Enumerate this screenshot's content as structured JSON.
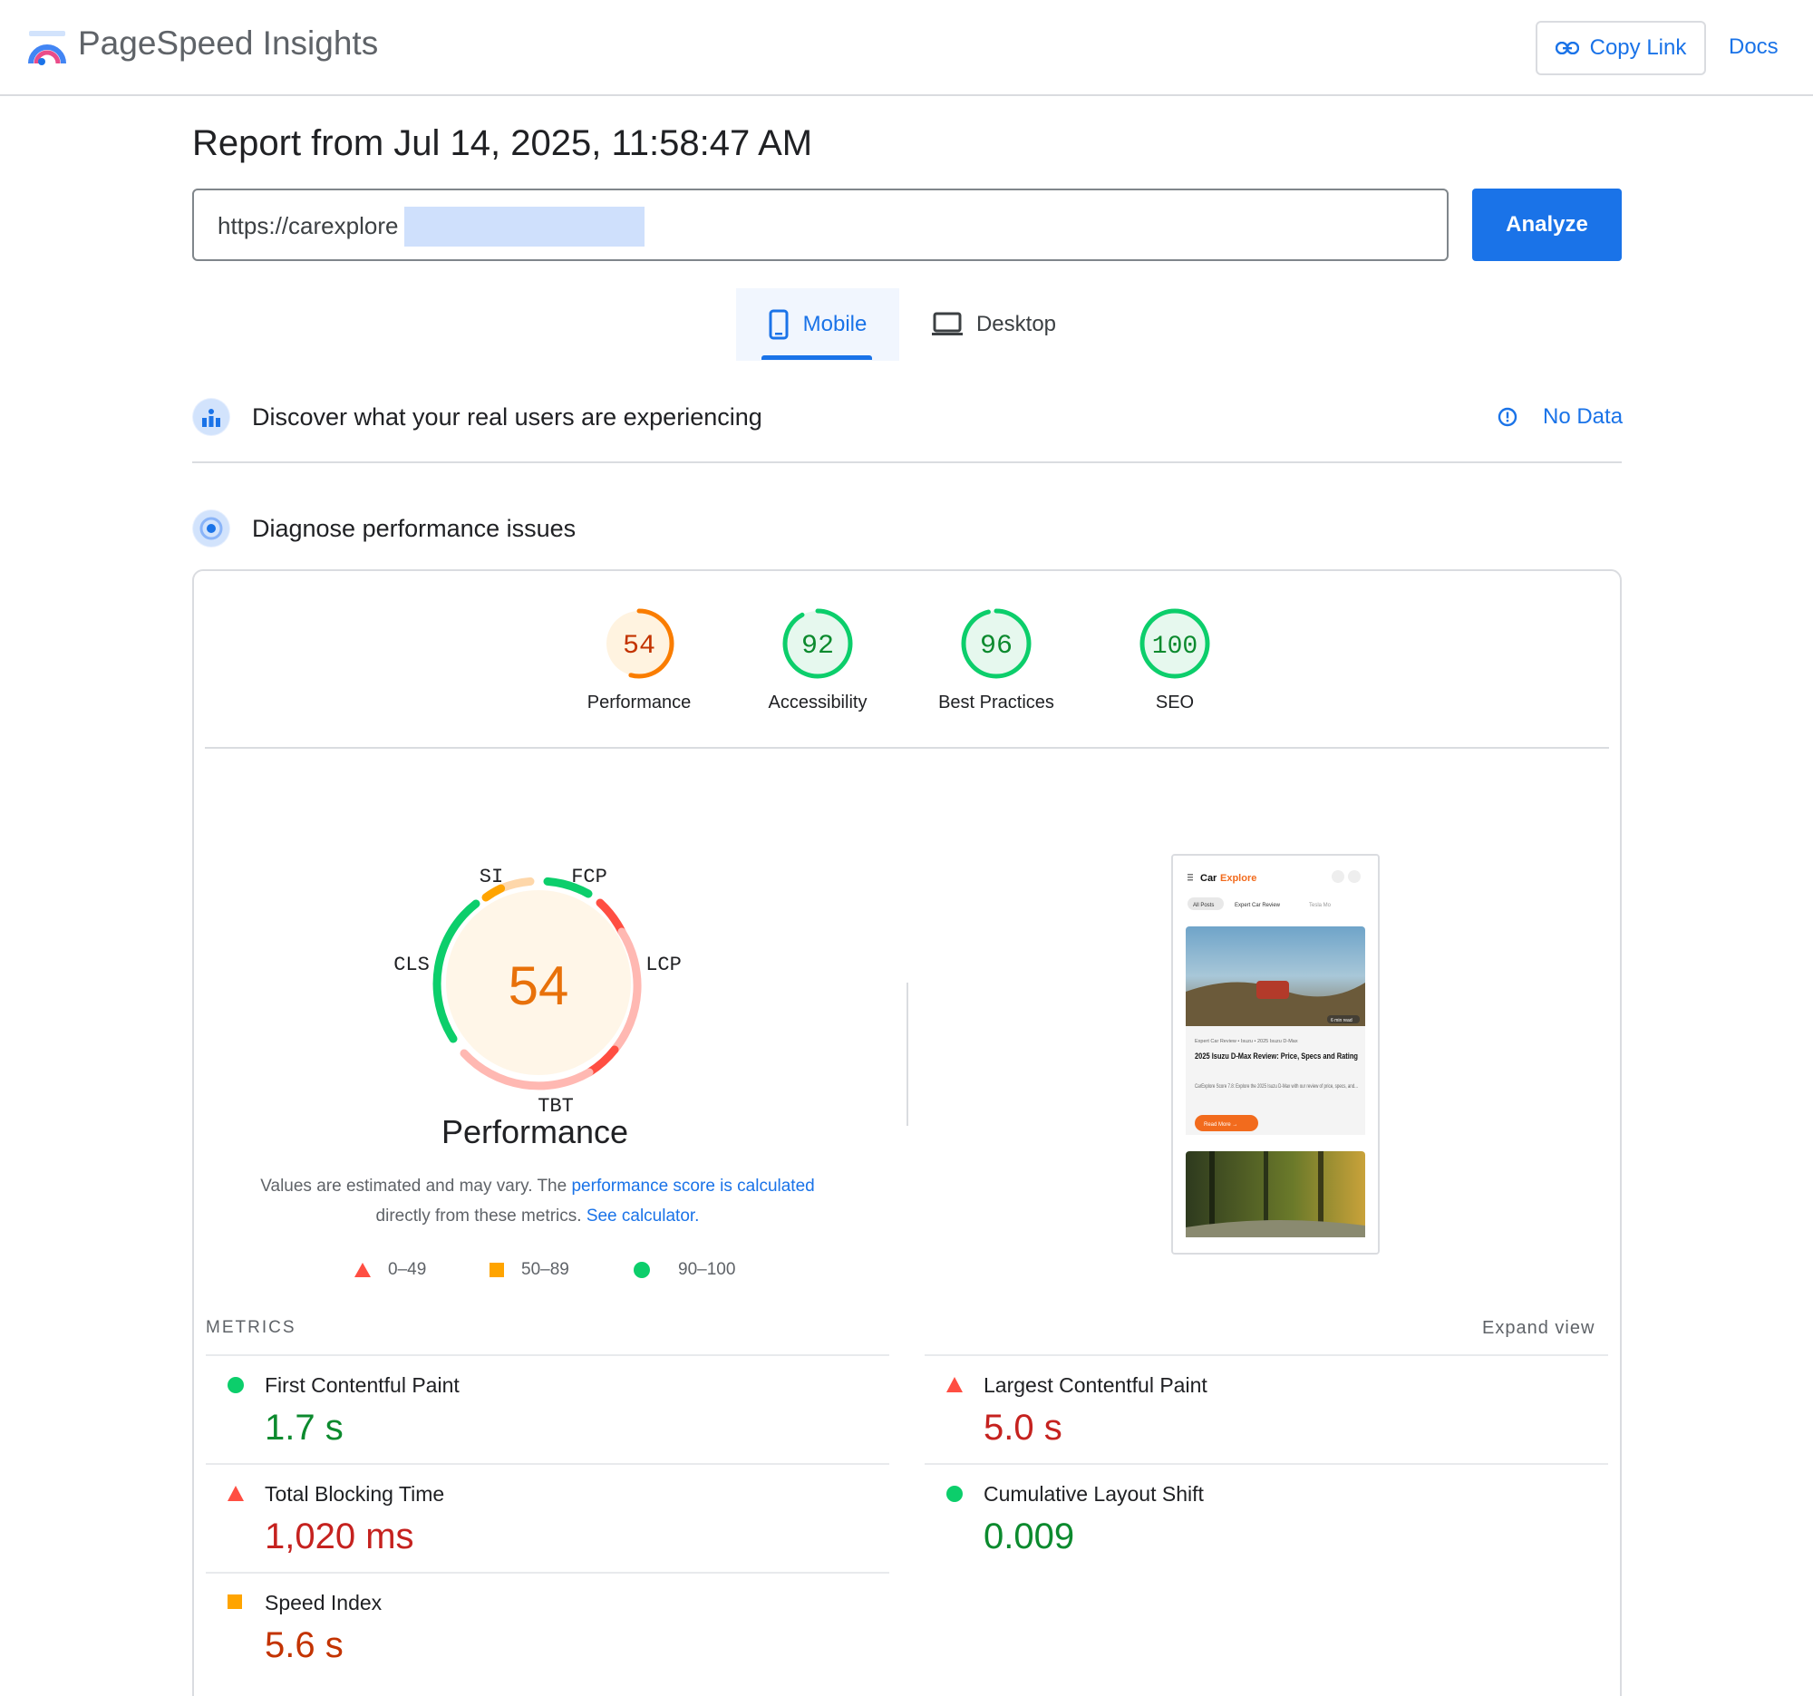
{
  "header": {
    "brand": "PageSpeed Insights",
    "copy_link": "Copy Link",
    "docs": "Docs"
  },
  "report": {
    "title": "Report from Jul 14, 2025, 11:58:47 AM",
    "url": "https://carexplore",
    "analyze": "Analyze"
  },
  "tabs": [
    {
      "label": "Mobile",
      "active": true
    },
    {
      "label": "Desktop",
      "active": false
    }
  ],
  "field_data": {
    "title": "Discover what your real users are experiencing",
    "status": "No Data"
  },
  "lab": {
    "title": "Diagnose performance issues"
  },
  "scores": [
    {
      "label": "Performance",
      "value": 54,
      "color": "#fa7d00"
    },
    {
      "label": "Accessibility",
      "value": 92,
      "color": "#0cce6b"
    },
    {
      "label": "Best Practices",
      "value": 96,
      "color": "#0cce6b"
    },
    {
      "label": "SEO",
      "value": 100,
      "color": "#0cce6b"
    }
  ],
  "performance_gauge": {
    "score": "54",
    "label": "Performance",
    "segments": [
      "SI",
      "FCP",
      "LCP",
      "TBT",
      "CLS"
    ]
  },
  "note": {
    "part1": "Values are estimated and may vary. The ",
    "link1": "performance score is calculated",
    "part2": "directly from these metrics. ",
    "link2": "See calculator."
  },
  "legend": {
    "poor": "0–49",
    "average": "50–89",
    "good": "90–100"
  },
  "preview": {
    "logo_a": "Car",
    "logo_b": "Explore",
    "chips": [
      "All Posts",
      "Expert Car Review",
      "Tesla Mo"
    ],
    "read_time": "6 min read",
    "crumb": "Expert Car Review • Isuzu • 2025 Isuzu D-Max",
    "headline": "2025 Isuzu D-Max Review: Price, Specs and Rating",
    "desc": "CarExplore Score 7.8: Explore the 2025 Isuzu D-Max with our review of price, specs, and...",
    "cta": "Read More →"
  },
  "metrics": {
    "heading": "METRICS",
    "expand": "Expand view",
    "items": [
      {
        "name": "First Contentful Paint",
        "value": "1.7 s",
        "rating": "good"
      },
      {
        "name": "Largest Contentful Paint",
        "value": "5.0 s",
        "rating": "poor"
      },
      {
        "name": "Total Blocking Time",
        "value": "1,020 ms",
        "rating": "poor"
      },
      {
        "name": "Cumulative Layout Shift",
        "value": "0.009",
        "rating": "good"
      },
      {
        "name": "Speed Index",
        "value": "5.6 s",
        "rating": "average"
      }
    ]
  },
  "colors": {
    "accent": "#1a73e8",
    "good": "#0cce6b",
    "average": "#ffa400",
    "poor": "#ff4e42"
  }
}
